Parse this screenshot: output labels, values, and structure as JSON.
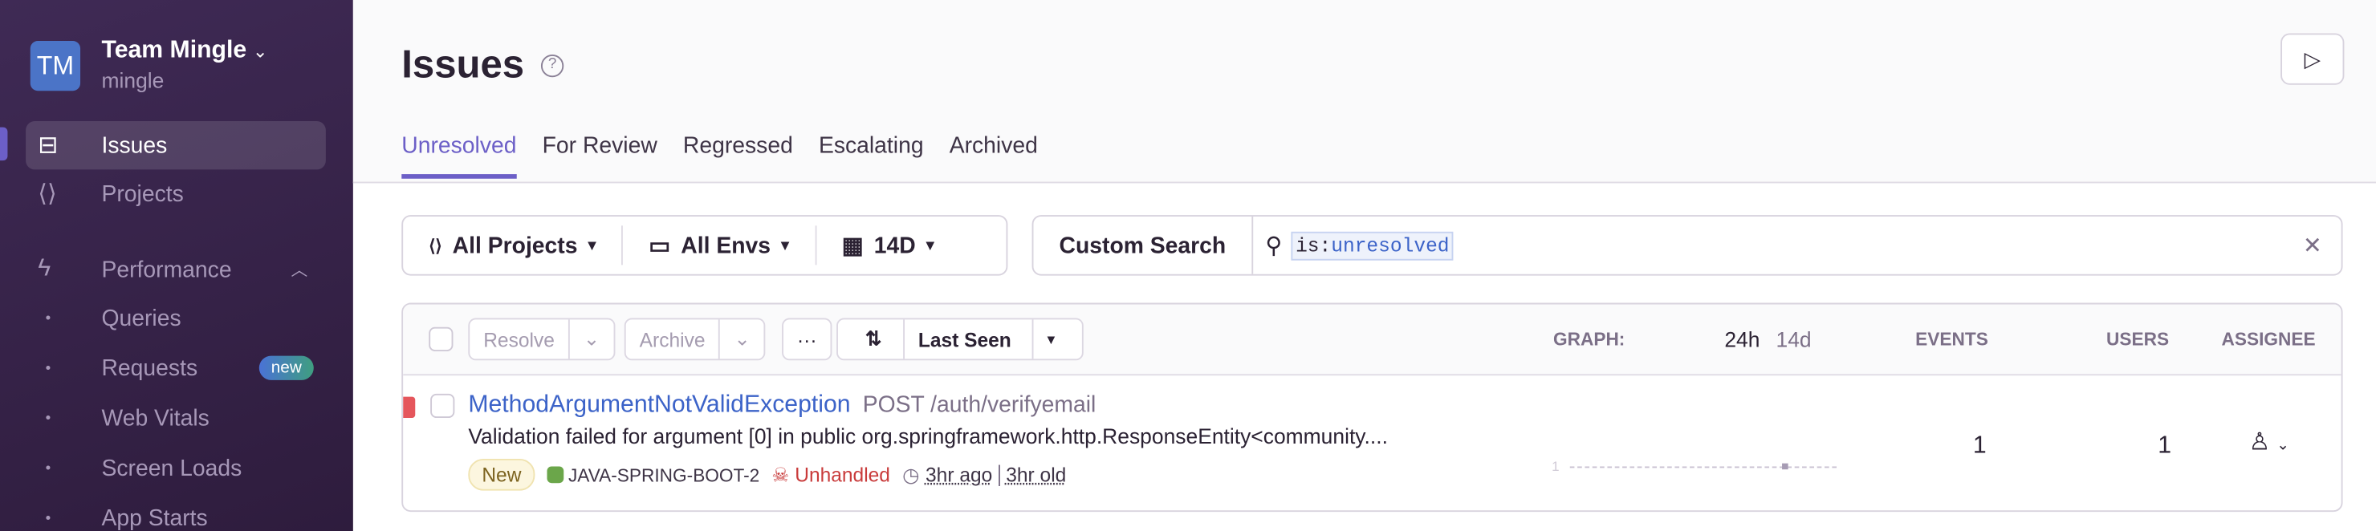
{
  "sidebar": {
    "avatar": "TM",
    "org_name": "Team Mingle",
    "org_slug": "mingle",
    "items": [
      {
        "label": "Issues",
        "icon": "inbox-icon"
      },
      {
        "label": "Projects",
        "icon": "folder-code-icon"
      },
      {
        "label": "Performance",
        "icon": "lightning-icon"
      }
    ],
    "subitems": [
      "Queries",
      "Requests",
      "Web Vitals",
      "Screen Loads",
      "App Starts"
    ],
    "new_badge": "new"
  },
  "header": {
    "title": "Issues",
    "help": "?",
    "tabs": [
      "Unresolved",
      "For Review",
      "Regressed",
      "Escalating",
      "Archived"
    ],
    "active_tab": "Unresolved"
  },
  "filters": {
    "projects": "All Projects",
    "envs": "All Envs",
    "period": "14D",
    "custom_search": "Custom Search",
    "query_key": "is:",
    "query_value": "unresolved"
  },
  "table": {
    "resolve": "Resolve",
    "archive": "Archive",
    "more": "···",
    "sort": "Last Seen",
    "graph": "GRAPH:",
    "g24h": "24h",
    "g14d": "14d",
    "events": "EVENTS",
    "users": "USERS",
    "assignee": "ASSIGNEE"
  },
  "issue": {
    "title": "MethodArgumentNotValidException",
    "culprit": "POST /auth/verifyemail",
    "message": "Validation failed for argument [0] in public org.springframework.http.ResponseEntity<community....",
    "status": "New",
    "project": "JAVA-SPRING-BOOT-2",
    "handled": "Unhandled",
    "last_seen": "3hr ago",
    "age": "3hr old",
    "graph_max": "1",
    "events": "1",
    "users": "1",
    "level_color": "#e5565c"
  }
}
